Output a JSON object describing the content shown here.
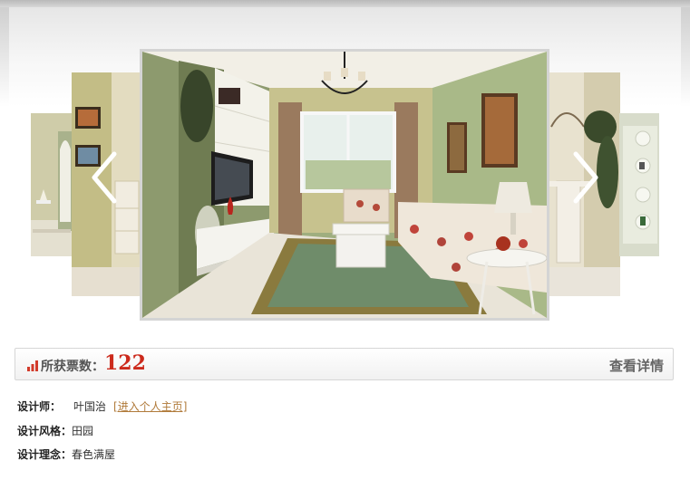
{
  "gallery": {
    "prev_icon": "chevron-left-icon",
    "next_icon": "chevron-right-icon"
  },
  "votes": {
    "label": "所获票数：",
    "count": "122",
    "details_link": "查看详情",
    "accent_color": "#cc2a1c"
  },
  "info": {
    "designer_key": "设计师：",
    "designer_name": "叶国治",
    "homepage_link": "[进入个人主页]",
    "style_key": "设计风格：",
    "style_value": "田园",
    "concept_key": "设计理念：",
    "concept_value": "春色满屋"
  }
}
